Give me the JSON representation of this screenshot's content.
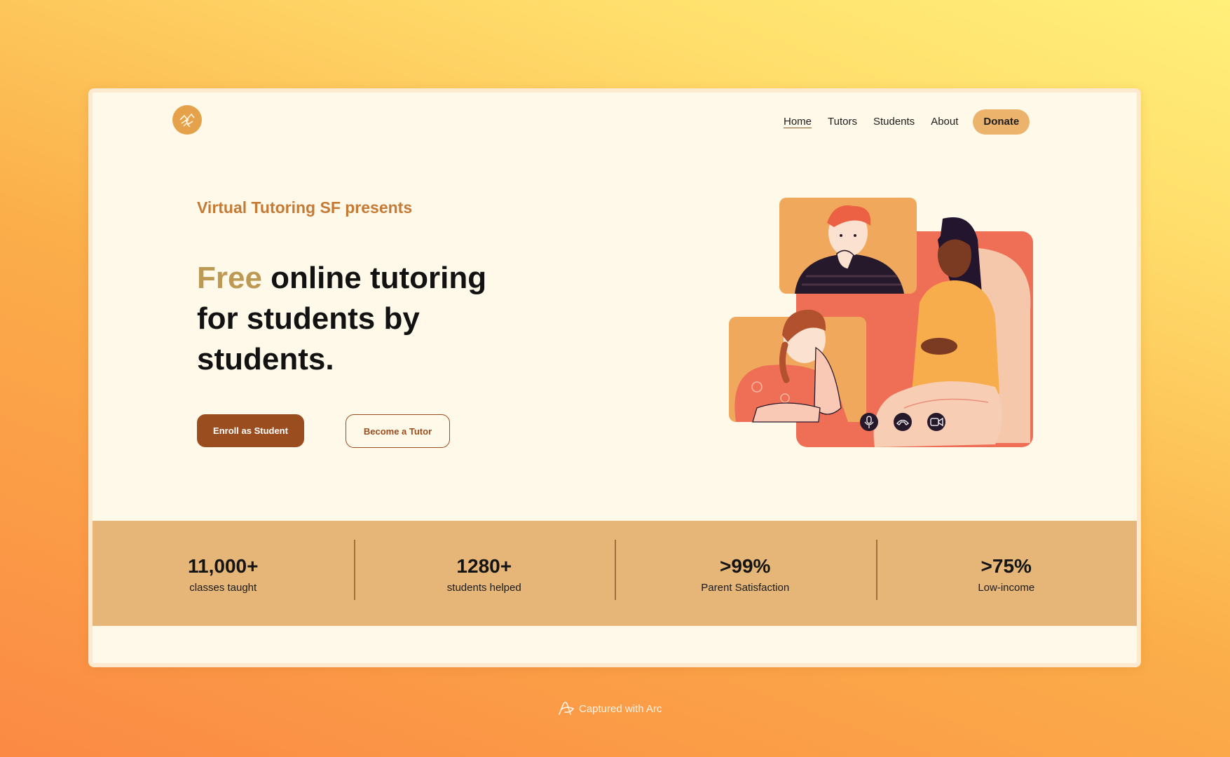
{
  "nav": {
    "items": [
      {
        "label": "Home",
        "active": true
      },
      {
        "label": "Tutors"
      },
      {
        "label": "Students"
      },
      {
        "label": "About"
      }
    ],
    "donate_label": "Donate"
  },
  "hero": {
    "eyebrow": "Virtual Tutoring SF presents",
    "headline_accent": "Free",
    "headline_rest": " online tutoring for students by students.",
    "primary_cta": "Enroll as Student",
    "secondary_cta": "Become a Tutor",
    "illustration_icons": [
      "microphone-icon",
      "phone-hangup-icon",
      "video-camera-icon"
    ]
  },
  "stats": [
    {
      "value": "11,000+",
      "label": "classes taught"
    },
    {
      "value": "1280+",
      "label": "students helped"
    },
    {
      "value": ">99%",
      "label": "Parent Satisfaction"
    },
    {
      "value": ">75%",
      "label": "Low-income"
    }
  ],
  "footer": {
    "capture_text": "Captured with Arc"
  },
  "colors": {
    "accent_orange": "#c57a35",
    "accent_gold": "#bd9a54",
    "primary_brown": "#9a4d1e",
    "donate_bg": "#ecb36c",
    "stats_band": "#e6b678",
    "page_bg": "#fff9e9"
  }
}
